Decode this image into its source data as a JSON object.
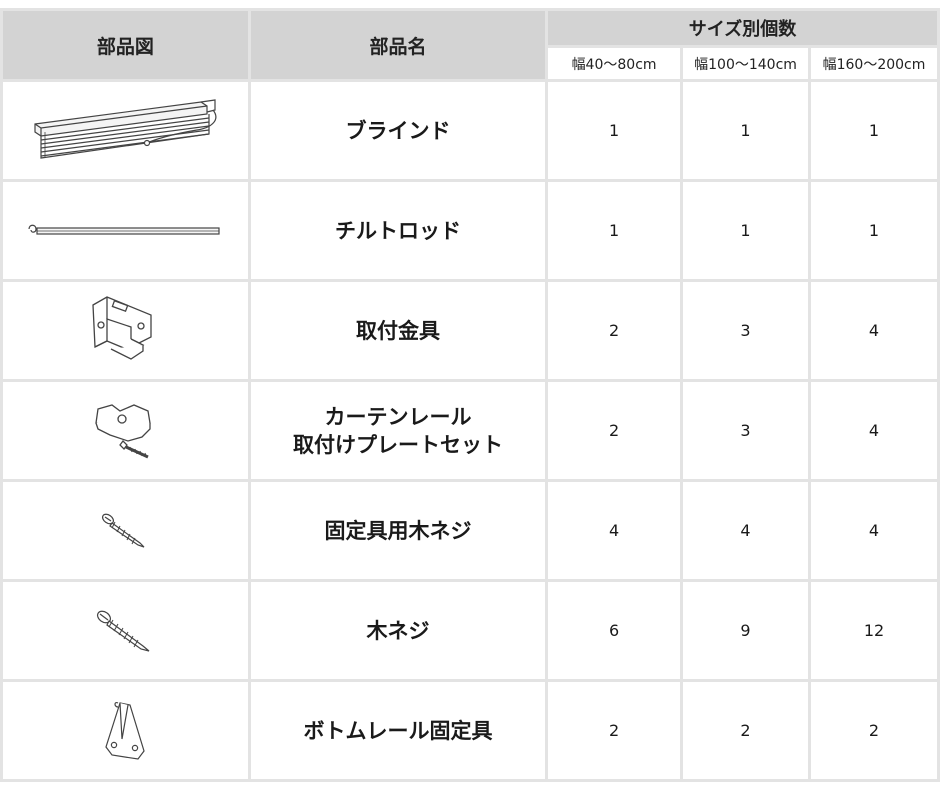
{
  "headers": {
    "figure": "部品図",
    "name": "部品名",
    "quantity_group": "サイズ別個数",
    "size_columns": [
      "幅40〜80cm",
      "幅100〜140cm",
      "幅160〜200cm"
    ]
  },
  "rows": [
    {
      "icon": "blind-icon",
      "name_lines": [
        "ブラインド"
      ],
      "qty": [
        "1",
        "1",
        "1"
      ]
    },
    {
      "icon": "tilt-rod-icon",
      "name_lines": [
        "チルトロッド"
      ],
      "qty": [
        "1",
        "1",
        "1"
      ]
    },
    {
      "icon": "mounting-bracket-icon",
      "name_lines": [
        "取付金具"
      ],
      "qty": [
        "2",
        "3",
        "4"
      ]
    },
    {
      "icon": "curtain-rail-plate-icon",
      "name_lines": [
        "カーテンレール",
        "取付けプレートセット"
      ],
      "qty": [
        "2",
        "3",
        "4"
      ]
    },
    {
      "icon": "wood-screw-small-icon",
      "name_lines": [
        "固定具用木ネジ"
      ],
      "qty": [
        "4",
        "4",
        "4"
      ]
    },
    {
      "icon": "wood-screw-icon",
      "name_lines": [
        "木ネジ"
      ],
      "qty": [
        "6",
        "9",
        "12"
      ]
    },
    {
      "icon": "bottom-rail-holder-icon",
      "name_lines": [
        "ボトムレール固定具"
      ],
      "qty": [
        "2",
        "2",
        "2"
      ]
    }
  ]
}
